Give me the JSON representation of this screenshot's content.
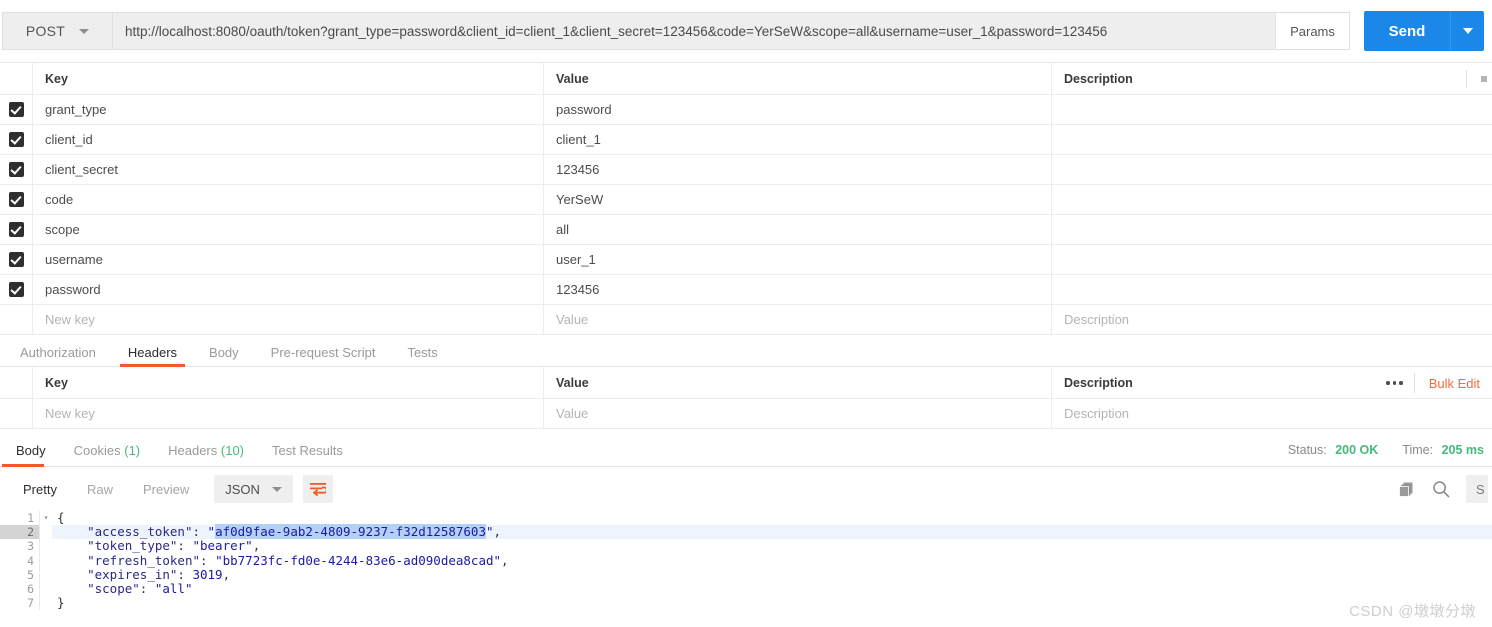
{
  "urlbar": {
    "method": "POST",
    "url": "http://localhost:8080/oauth/token?grant_type=password&client_id=client_1&client_secret=123456&code=YerSeW&scope=all&username=user_1&password=123456",
    "params_label": "Params",
    "send_label": "Send"
  },
  "params_table": {
    "columns": [
      "Key",
      "Value",
      "Description"
    ],
    "rows": [
      {
        "checked": true,
        "key": "grant_type",
        "value": "password",
        "description": ""
      },
      {
        "checked": true,
        "key": "client_id",
        "value": "client_1",
        "description": ""
      },
      {
        "checked": true,
        "key": "client_secret",
        "value": "123456",
        "description": ""
      },
      {
        "checked": true,
        "key": "code",
        "value": "YerSeW",
        "description": ""
      },
      {
        "checked": true,
        "key": "scope",
        "value": "all",
        "description": ""
      },
      {
        "checked": true,
        "key": "username",
        "value": "user_1",
        "description": ""
      },
      {
        "checked": true,
        "key": "password",
        "value": "123456",
        "description": ""
      }
    ],
    "new_row": {
      "key_placeholder": "New key",
      "value_placeholder": "Value",
      "description_placeholder": "Description"
    }
  },
  "request_tabs": [
    {
      "label": "Authorization",
      "active": false
    },
    {
      "label": "Headers",
      "active": true
    },
    {
      "label": "Body",
      "active": false
    },
    {
      "label": "Pre-request Script",
      "active": false
    },
    {
      "label": "Tests",
      "active": false
    }
  ],
  "headers_table": {
    "columns": [
      "Key",
      "Value",
      "Description"
    ],
    "bulk_edit_label": "Bulk Edit",
    "new_row": {
      "key_placeholder": "New key",
      "value_placeholder": "Value",
      "description_placeholder": "Description"
    }
  },
  "response_tabs": [
    {
      "label": "Body",
      "count": "",
      "active": true
    },
    {
      "label": "Cookies",
      "count": "(1)",
      "active": false
    },
    {
      "label": "Headers",
      "count": "(10)",
      "active": false
    },
    {
      "label": "Test Results",
      "count": "",
      "active": false
    }
  ],
  "response_status": {
    "status_label": "Status:",
    "status_value": "200 OK",
    "time_label": "Time:",
    "time_value": "205 ms"
  },
  "body_toolbar": {
    "formats": [
      {
        "label": "Pretty",
        "active": true
      },
      {
        "label": "Raw",
        "active": false
      },
      {
        "label": "Preview",
        "active": false
      }
    ],
    "language": "JSON",
    "save_label": "S"
  },
  "response_body": {
    "lines": [
      {
        "num": "1",
        "fold": "▾",
        "segments": [
          {
            "t": "{",
            "c": "p"
          }
        ],
        "active": false
      },
      {
        "num": "2",
        "fold": "",
        "segments": [
          {
            "t": "    ",
            "c": "p"
          },
          {
            "t": "\"access_token\"",
            "c": "k"
          },
          {
            "t": ": ",
            "c": "p"
          },
          {
            "t": "\"",
            "c": "s"
          },
          {
            "t": "af0d9fae-9ab2-4809-9237-f32d12587603",
            "c": "s sel"
          },
          {
            "t": "\"",
            "c": "s"
          },
          {
            "t": ",",
            "c": "p"
          }
        ],
        "active": true
      },
      {
        "num": "3",
        "fold": "",
        "segments": [
          {
            "t": "    ",
            "c": "p"
          },
          {
            "t": "\"token_type\"",
            "c": "k"
          },
          {
            "t": ": ",
            "c": "p"
          },
          {
            "t": "\"bearer\"",
            "c": "s"
          },
          {
            "t": ",",
            "c": "p"
          }
        ],
        "active": false
      },
      {
        "num": "4",
        "fold": "",
        "segments": [
          {
            "t": "    ",
            "c": "p"
          },
          {
            "t": "\"refresh_token\"",
            "c": "k"
          },
          {
            "t": ": ",
            "c": "p"
          },
          {
            "t": "\"bb7723fc-fd0e-4244-83e6-ad090dea8cad\"",
            "c": "s"
          },
          {
            "t": ",",
            "c": "p"
          }
        ],
        "active": false
      },
      {
        "num": "5",
        "fold": "",
        "segments": [
          {
            "t": "    ",
            "c": "p"
          },
          {
            "t": "\"expires_in\"",
            "c": "k"
          },
          {
            "t": ": ",
            "c": "p"
          },
          {
            "t": "3019",
            "c": "n"
          },
          {
            "t": ",",
            "c": "p"
          }
        ],
        "active": false
      },
      {
        "num": "6",
        "fold": "",
        "segments": [
          {
            "t": "    ",
            "c": "p"
          },
          {
            "t": "\"scope\"",
            "c": "k"
          },
          {
            "t": ": ",
            "c": "p"
          },
          {
            "t": "\"all\"",
            "c": "s"
          }
        ],
        "active": false
      },
      {
        "num": "7",
        "fold": "",
        "segments": [
          {
            "t": "}",
            "c": "p"
          }
        ],
        "active": false
      }
    ]
  },
  "watermark": "CSDN @墩墩分墩"
}
